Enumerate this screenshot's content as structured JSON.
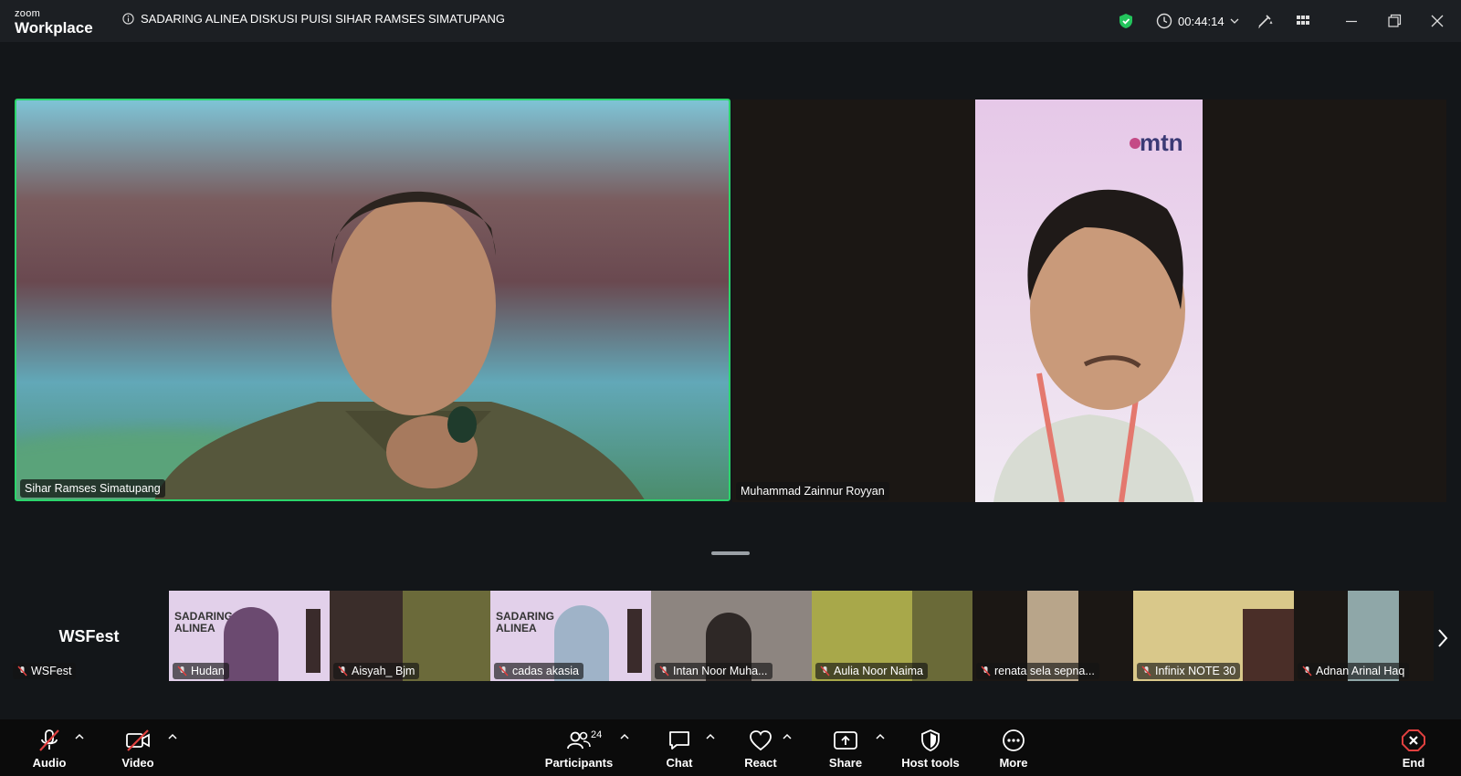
{
  "app": {
    "brand_small": "zoom",
    "brand_large": "Workplace"
  },
  "meeting": {
    "title": "SADARING ALINEA DISKUSI PUISI SIHAR RAMSES SIMATUPANG",
    "elapsed": "00:44:14"
  },
  "speakers": {
    "active": "Sihar Ramses Simatupang",
    "second": "Muhammad Zainnur Royyan",
    "second_banner_text": "mtn"
  },
  "strip": {
    "self_display": "WSFest",
    "self_name": "WSFest",
    "thumbnails": [
      {
        "name": "Hudan",
        "poster_text": "SADARING ALINEA"
      },
      {
        "name": "Aisyah_ Bjm"
      },
      {
        "name": "cadas akasia",
        "poster_text": "SADARING ALINEA"
      },
      {
        "name": "Intan Noor Muha..."
      },
      {
        "name": "Aulia Noor Naima"
      },
      {
        "name": "renata sela sepna..."
      },
      {
        "name": "Infinix NOTE 30"
      },
      {
        "name": "Adnan Arinal Haq"
      }
    ]
  },
  "toolbar": {
    "audio": "Audio",
    "video": "Video",
    "participants": "Participants",
    "participants_count": "24",
    "chat": "Chat",
    "react": "React",
    "share": "Share",
    "host_tools": "Host tools",
    "more": "More",
    "end": "End"
  },
  "colors": {
    "active_border": "#2bd56b",
    "end": "#e0403f",
    "shield": "#23c45c"
  },
  "icons": [
    "info-icon",
    "shield-icon",
    "clock-icon",
    "chevron-down-icon",
    "annotate-icon",
    "grid-view-icon",
    "minimize-icon",
    "restore-icon",
    "close-icon",
    "mic-off-icon",
    "video-off-icon",
    "participants-icon",
    "chat-icon",
    "react-icon",
    "share-icon",
    "host-tools-icon",
    "more-icon",
    "end-icon",
    "chevron-right-icon"
  ]
}
